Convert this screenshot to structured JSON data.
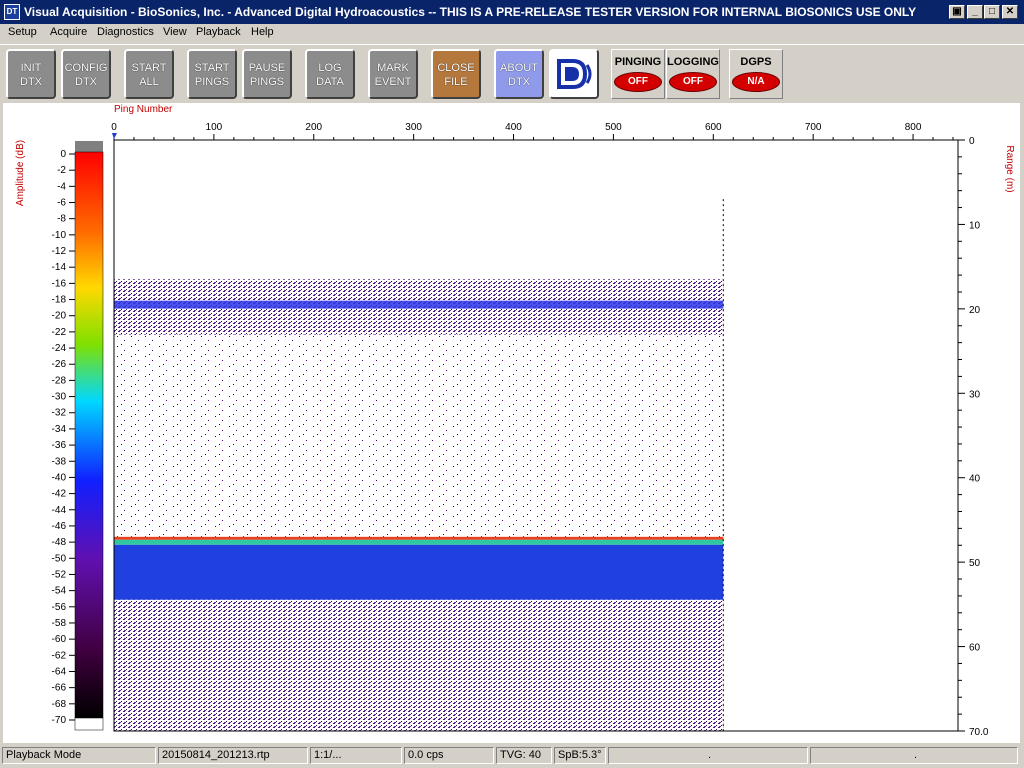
{
  "window": {
    "title": "Visual Acquisition  -  BioSonics, Inc.  -  Advanced Digital Hydroacoustics  -- THIS IS A PRE-RELEASE TESTER VERSION FOR INTERNAL BIOSONICS USE ONLY",
    "icon_text": "DT"
  },
  "menu": [
    "Setup",
    "Acquire",
    "Diagnostics",
    "View",
    "Playback",
    "Help"
  ],
  "toolbar": {
    "buttons": [
      {
        "line1": "INIT",
        "line2": "DTX"
      },
      {
        "line1": "CONFIG",
        "line2": "DTX"
      },
      {
        "line1": "START",
        "line2": "ALL"
      },
      {
        "line1": "START",
        "line2": "PINGS"
      },
      {
        "line1": "PAUSE",
        "line2": "PINGS"
      },
      {
        "line1": "LOG",
        "line2": "DATA"
      },
      {
        "line1": "MARK",
        "line2": "EVENT"
      },
      {
        "line1": "CLOSE",
        "line2": "FILE"
      },
      {
        "line1": "ABOUT",
        "line2": "DTX"
      }
    ],
    "indicators": [
      {
        "label": "PINGING",
        "state": "OFF"
      },
      {
        "label": "LOGGING",
        "state": "OFF"
      },
      {
        "label": "DGPS",
        "state": "N/A"
      }
    ],
    "colors": {
      "gray": "#8c8c8c",
      "orange": "#b5783c",
      "blue": "#8f9bea",
      "led": "#d40000"
    }
  },
  "echogram": {
    "x_label": "Ping Number",
    "x_ticks": [
      "0",
      "100",
      "200",
      "300",
      "400",
      "500",
      "600",
      "700",
      "800"
    ],
    "y_label": "Range (m)",
    "y_ticks": [
      "0",
      "10",
      "20",
      "30",
      "40",
      "50",
      "60",
      "70.0"
    ],
    "amp_label": "Amplitude (dB)",
    "amp_ticks": [
      "0",
      "-2",
      "-4",
      "-6",
      "-8",
      "-10",
      "-12",
      "-14",
      "-16",
      "-18",
      "-20",
      "-22",
      "-24",
      "-26",
      "-28",
      "-30",
      "-32",
      "-34",
      "-36",
      "-38",
      "-40",
      "-42",
      "-44",
      "-46",
      "-48",
      "-50",
      "-52",
      "-54",
      "-56",
      "-58",
      "-60",
      "-62",
      "-64",
      "-66",
      "-68",
      "-70"
    ],
    "pings_recorded": 610,
    "range_max": 70,
    "ping_max": 845,
    "surface_layer_range": [
      16.5,
      19.5
    ],
    "bottom_range": 47
  },
  "status": [
    "Playback Mode",
    "20150814_201213.rtp",
    "1:1/...",
    "0.0 cps",
    "TVG: 40",
    "SpB:5.3°",
    ".",
    "."
  ]
}
